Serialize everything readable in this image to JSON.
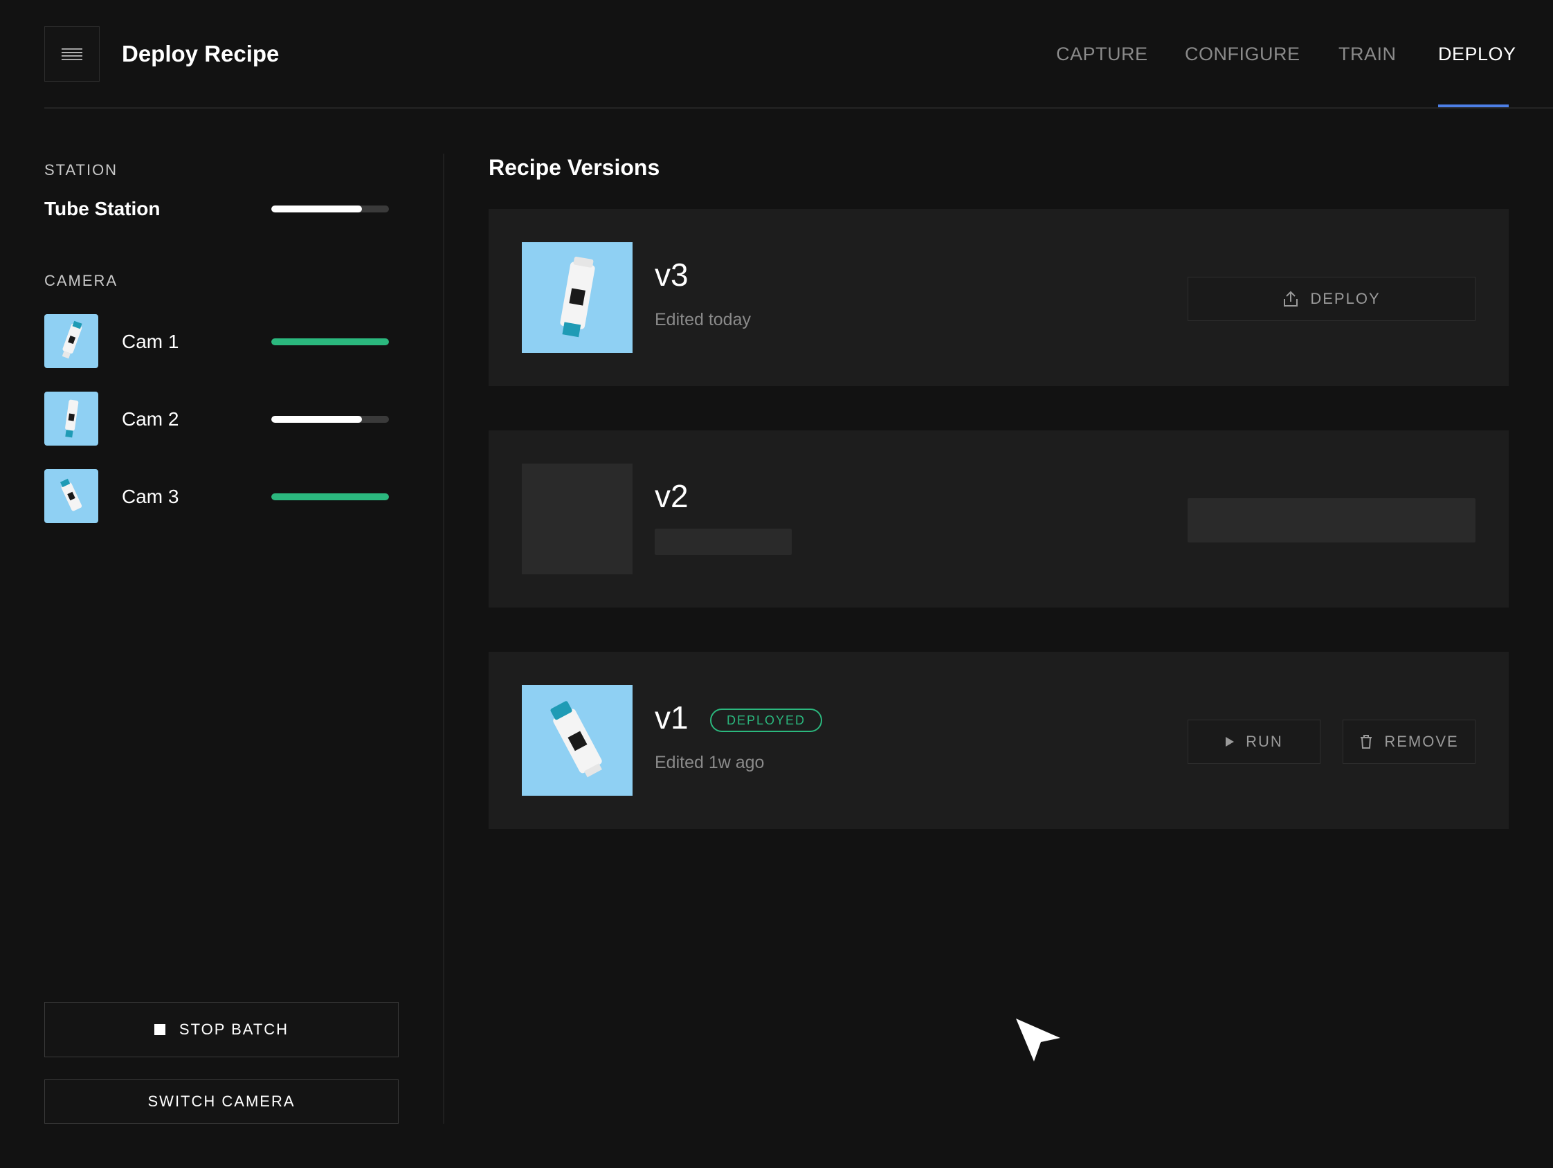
{
  "header": {
    "title": "Deploy Recipe",
    "tabs": [
      {
        "label": "CAPTURE",
        "active": false
      },
      {
        "label": "CONFIGURE",
        "active": false
      },
      {
        "label": "TRAIN",
        "active": false
      },
      {
        "label": "DEPLOY",
        "active": true
      }
    ]
  },
  "sidebar": {
    "station_label": "STATION",
    "station_name": "Tube Station",
    "station_progress": 0.77,
    "camera_label": "CAMERA",
    "cameras": [
      {
        "name": "Cam 1",
        "progress": 1.0,
        "status_color": "#2bb87e"
      },
      {
        "name": "Cam 2",
        "progress": 0.77,
        "status_color": "#ffffff"
      },
      {
        "name": "Cam 3",
        "progress": 1.0,
        "status_color": "#2bb87e"
      }
    ],
    "stop_batch_label": "STOP BATCH",
    "switch_camera_label": "SWITCH CAMERA"
  },
  "main": {
    "title": "Recipe Versions",
    "versions": [
      {
        "version": "v3",
        "edited": "Edited today",
        "action": "DEPLOY",
        "icon": "upload-icon"
      },
      {
        "version": "v2",
        "loading": true
      },
      {
        "version": "v1",
        "edited": "Edited 1w ago",
        "badge": "DEPLOYED",
        "actions": [
          "RUN",
          "REMOVE"
        ],
        "icons": [
          "play-icon",
          "trash-icon"
        ]
      }
    ]
  },
  "colors": {
    "background": "#121212",
    "card": "#1d1d1d",
    "accent_blue": "#4d7fe6",
    "status_green": "#2bb87e",
    "thumb_blue": "#8fd0f3"
  }
}
